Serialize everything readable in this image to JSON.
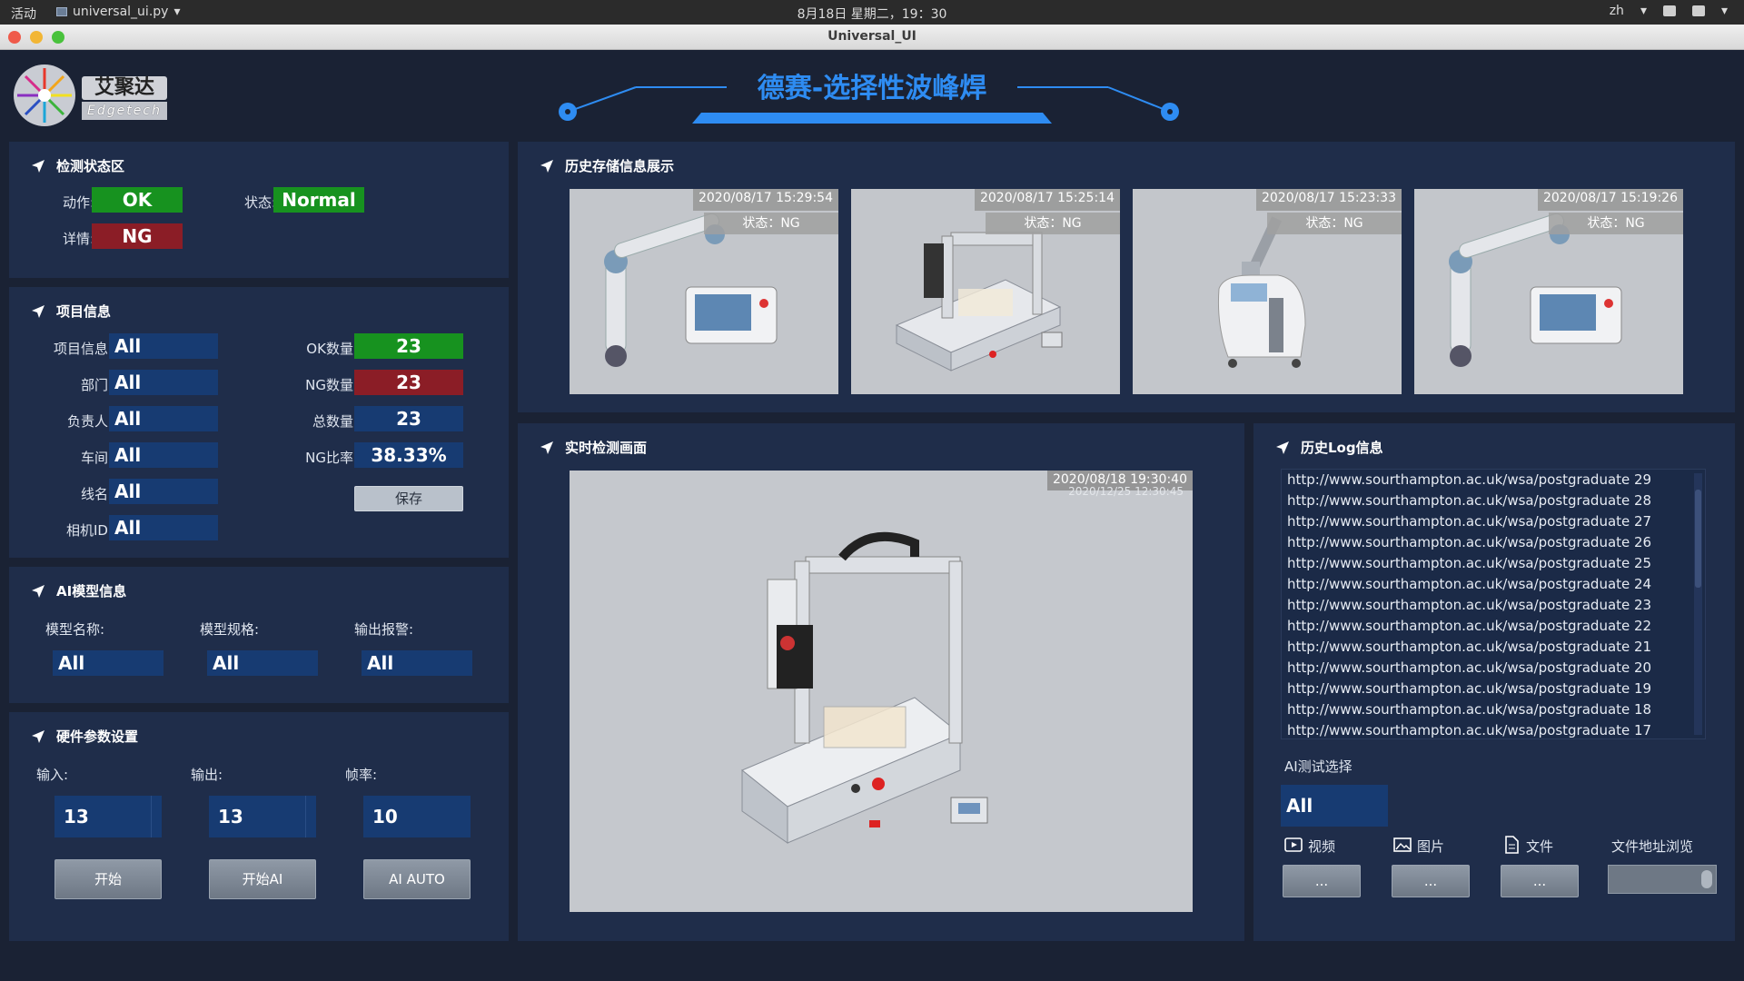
{
  "system_bar": {
    "activities": "活动",
    "app_name": "universal_ui.py",
    "clock": "8月18日 星期二，19：30",
    "lang": "zh"
  },
  "window": {
    "title": "Universal_UI"
  },
  "header": {
    "logo_cn": "艾聚达",
    "logo_en": "Edgetech",
    "title": "德赛-选择性波峰焊"
  },
  "status_panel": {
    "title": "检测状态区",
    "action_label": "动作:",
    "action_value": "OK",
    "state_label": "状态:",
    "state_value": "Normal",
    "detail_label": "详情:",
    "detail_value": "NG"
  },
  "project_panel": {
    "title": "项目信息",
    "fields": [
      {
        "label": "项目信息:",
        "value": "All"
      },
      {
        "label": "部门:",
        "value": "All"
      },
      {
        "label": "负责人:",
        "value": "All"
      },
      {
        "label": "车间:",
        "value": "All"
      },
      {
        "label": "线名:",
        "value": "All"
      },
      {
        "label": "相机ID:",
        "value": "All"
      }
    ],
    "stats": [
      {
        "label": "OK数量:",
        "value": "23"
      },
      {
        "label": "NG数量:",
        "value": "23"
      },
      {
        "label": "总数量:",
        "value": "23"
      },
      {
        "label": "NG比率:",
        "value": "38.33%"
      }
    ],
    "save_label": "保存"
  },
  "ai_panel": {
    "title": "AI模型信息",
    "fields": [
      {
        "label": "模型名称:",
        "value": "All"
      },
      {
        "label": "模型规格:",
        "value": "All"
      },
      {
        "label": "输出报警:",
        "value": "All"
      }
    ]
  },
  "hw_panel": {
    "title": "硬件参数设置",
    "input_label": "输入:",
    "input_value": "13",
    "output_label": "输出:",
    "output_value": "13",
    "fps_label": "帧率:",
    "fps_value": "10",
    "start_label": "开始",
    "start_ai_label": "开始AI",
    "ai_auto_label": "AI AUTO"
  },
  "history_panel": {
    "title": "历史存储信息展示",
    "items": [
      {
        "timestamp": "2020/08/17 15:29:54",
        "status": "状态：NG",
        "kind": "robot-arm"
      },
      {
        "timestamp": "2020/08/17 15:25:14",
        "status": "状态：NG",
        "kind": "dispenser"
      },
      {
        "timestamp": "2020/08/17 15:23:33",
        "status": "状态：NG",
        "kind": "laser-machine"
      },
      {
        "timestamp": "2020/08/17 15:19:26",
        "status": "状态：NG",
        "kind": "robot-arm"
      }
    ]
  },
  "live_panel": {
    "title": "实时检测画面",
    "timestamp": "2020/08/18 19:30:40",
    "timestamp_ghost": "2020/12/25 12:30:45"
  },
  "log_panel": {
    "title": "历史Log信息",
    "entries": [
      "http://www.sourthampton.ac.uk/wsa/postgraduate 29",
      "http://www.sourthampton.ac.uk/wsa/postgraduate 28",
      "http://www.sourthampton.ac.uk/wsa/postgraduate 27",
      "http://www.sourthampton.ac.uk/wsa/postgraduate 26",
      "http://www.sourthampton.ac.uk/wsa/postgraduate 25",
      "http://www.sourthampton.ac.uk/wsa/postgraduate 24",
      "http://www.sourthampton.ac.uk/wsa/postgraduate 23",
      "http://www.sourthampton.ac.uk/wsa/postgraduate 22",
      "http://www.sourthampton.ac.uk/wsa/postgraduate 21",
      "http://www.sourthampton.ac.uk/wsa/postgraduate 20",
      "http://www.sourthampton.ac.uk/wsa/postgraduate 19",
      "http://www.sourthampton.ac.uk/wsa/postgraduate 18",
      "http://www.sourthampton.ac.uk/wsa/postgraduate 17"
    ],
    "ai_test_label": "AI测试选择",
    "ai_test_value": "All",
    "video_label": "视频",
    "image_label": "图片",
    "file_label": "文件",
    "browse_label": "文件地址浏览",
    "ellipsis": "..."
  },
  "colors": {
    "background": "#1a2234",
    "panel": "#1f2d4a",
    "value_box": "#173b72",
    "ok_green": "#17921f",
    "ng_red": "#8b1d26",
    "accent_blue": "#2e8cf2"
  }
}
